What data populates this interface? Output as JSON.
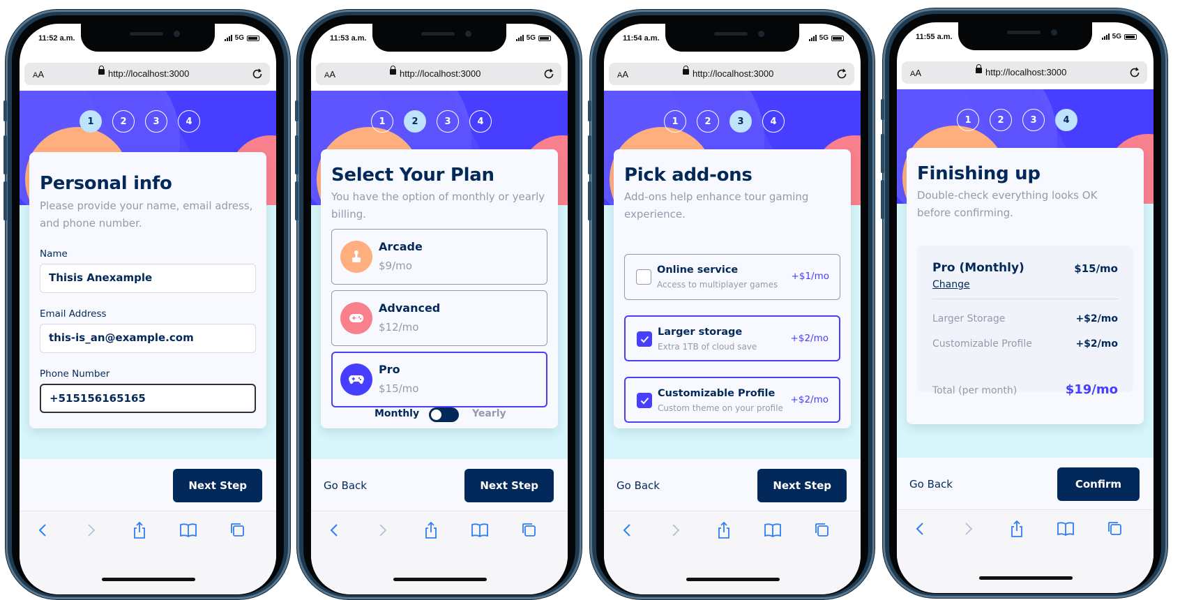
{
  "phones": [
    {
      "time": "11:52 a.m.",
      "network": "5G",
      "url_aa_small": "A",
      "url_aa_large": "A",
      "url": "http://localhost:3000",
      "steps": [
        "1",
        "2",
        "3",
        "4"
      ],
      "active_step": 1,
      "title": "Personal info",
      "subtitle": "Please provide your name, email adress, and phone number.",
      "fields": [
        {
          "label": "Name",
          "value": "Thisis Anexample"
        },
        {
          "label": "Email Address",
          "value": "this-is_an@example.com"
        },
        {
          "label": "Phone Number",
          "value": "+515156165165"
        }
      ],
      "next_label": "Next Step"
    },
    {
      "time": "11:53 a.m.",
      "network": "5G",
      "url_aa_small": "A",
      "url_aa_large": "A",
      "url": "http://localhost:3000",
      "steps": [
        "1",
        "2",
        "3",
        "4"
      ],
      "active_step": 2,
      "title": "Select Your Plan",
      "subtitle": "You have the option of monthly or yearly billing.",
      "plans": [
        {
          "name": "Arcade",
          "price": "$9/mo",
          "icon": "arcade-icon",
          "color": "#ffaf7e",
          "selected": false
        },
        {
          "name": "Advanced",
          "price": "$12/mo",
          "icon": "gamepad-icon",
          "color": "#f9818e",
          "selected": false
        },
        {
          "name": "Pro",
          "price": "$15/mo",
          "icon": "controller-icon",
          "color": "#483eff",
          "selected": true
        }
      ],
      "monthly_label": "Monthly",
      "yearly_label": "Yearly",
      "back_label": "Go Back",
      "next_label": "Next Step"
    },
    {
      "time": "11:54 a.m.",
      "network": "5G",
      "url_aa_small": "A",
      "url_aa_large": "A",
      "url": "http://localhost:3000",
      "steps": [
        "1",
        "2",
        "3",
        "4"
      ],
      "active_step": 3,
      "title": "Pick add-ons",
      "subtitle": "Add-ons help enhance tour gaming experience.",
      "addons": [
        {
          "name": "Online service",
          "desc": "Access to multiplayer games",
          "price": "+$1/mo",
          "checked": false
        },
        {
          "name": "Larger storage",
          "desc": "Extra 1TB of cloud save",
          "price": "+$2/mo",
          "checked": true
        },
        {
          "name": "Customizable Profile",
          "desc": "Custom theme on your profile",
          "price": "+$2/mo",
          "checked": true
        }
      ],
      "back_label": "Go Back",
      "next_label": "Next Step"
    },
    {
      "time": "11:55 a.m.",
      "network": "5G",
      "url_aa_small": "A",
      "url_aa_large": "A",
      "url": "http://localhost:3000",
      "steps": [
        "1",
        "2",
        "3",
        "4"
      ],
      "active_step": 4,
      "title": "Finishing up",
      "subtitle": "Double-check everything looks OK before confirming.",
      "summary": {
        "plan": "Pro (Monthly)",
        "plan_price": "$15/mo",
        "change": "Change",
        "addons": [
          {
            "name": "Larger Storage",
            "price": "+$2/mo"
          },
          {
            "name": "Customizable Profile",
            "price": "+$2/mo"
          }
        ],
        "total_label": "Total (per month)",
        "total": "$19/mo"
      },
      "back_label": "Go Back",
      "confirm_label": "Confirm"
    }
  ],
  "colors": {
    "marine_blue": "#02295a",
    "purplish_blue": "#483eff",
    "light_blue": "#bfe2fd",
    "cool_gray": "#9699ab",
    "magnolia": "#f8f9fe",
    "bg_lower": "#d6f6fb"
  },
  "toolbar_icons": [
    "back-chevron-icon",
    "forward-chevron-icon",
    "share-icon",
    "bookmarks-icon",
    "tabs-icon"
  ]
}
